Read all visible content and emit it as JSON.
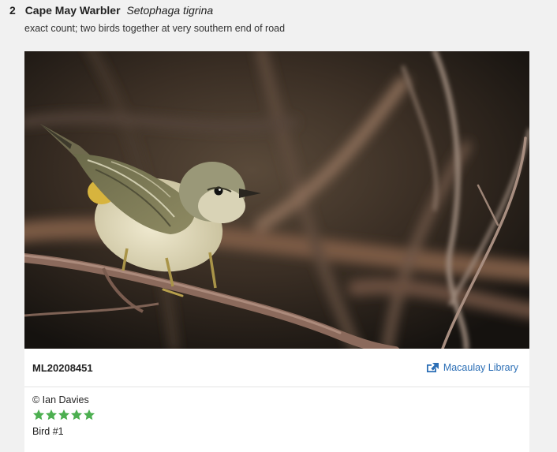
{
  "header": {
    "count": "2",
    "common_name": "Cape May Warbler",
    "scientific_name": "Setophaga tigrina"
  },
  "comment": "exact count; two birds together at very southern end of road",
  "media": {
    "asset_id": "ML20208451",
    "library_link": "Macaulay Library",
    "credit": "© Ian Davies",
    "rating": 5,
    "rating_max": 5,
    "caption": "Bird #1"
  },
  "colors": {
    "link": "#2c6fb6",
    "star": "#4caf50"
  },
  "icons": [
    "external-link-icon",
    "star-icon"
  ]
}
